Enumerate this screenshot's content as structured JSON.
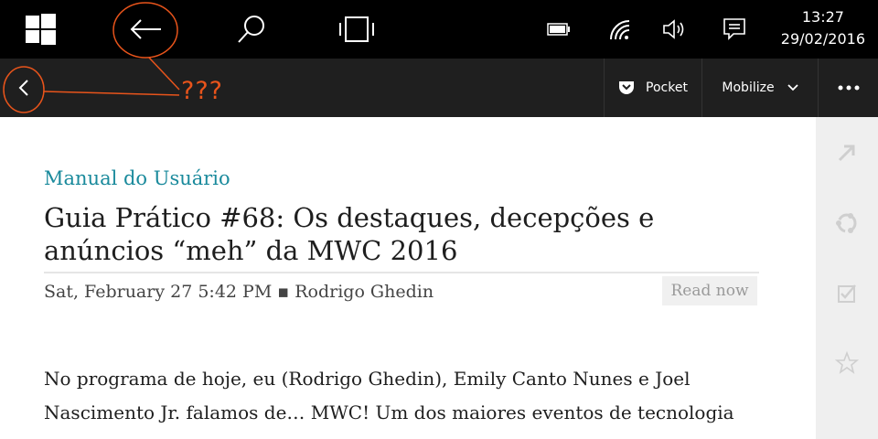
{
  "system_bar": {
    "icons": [
      "windows-icon",
      "back-arrow-icon",
      "search-icon",
      "task-view-icon",
      "battery-icon",
      "wifi-icon",
      "volume-icon",
      "action-center-icon"
    ],
    "time": "13:27",
    "date": "29/02/2016"
  },
  "annotation": {
    "text": "???",
    "color": "#e8541b"
  },
  "app_bar": {
    "back_icon": "chevron-left-icon",
    "pocket_label": "Pocket",
    "mobilize_label": "Mobilize",
    "more_icon": "more-dots-icon"
  },
  "article": {
    "category": "Manual do Usuário",
    "title": "Guia Prático #68: Os destaques, decepções e anúncios “meh” da MWC 2016",
    "meta": "Sat, February 27 5:42 PM ▪ Rodrigo Ghedin",
    "read_now": "Read now",
    "body": "No programa de hoje, eu (Rodrigo Ghedin), Emily Canto Nunes e Joel Nascimento Jr. falamos de… MWC! Um dos maiores eventos de tecnologia"
  },
  "side_rail": {
    "icons": [
      "share-arrow-icon",
      "sync-icon",
      "checkbox-icon",
      "star-icon"
    ]
  },
  "colors": {
    "accent": "#1a8a9c",
    "annotation": "#e8541b",
    "system_bar": "#000000",
    "app_bar": "#1f1f1f"
  }
}
